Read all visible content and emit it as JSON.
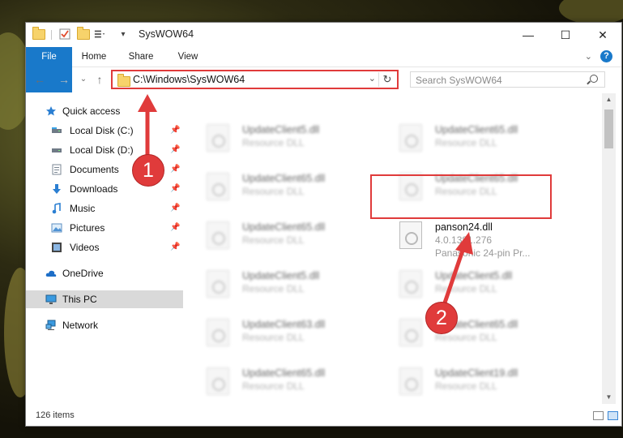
{
  "window": {
    "title": "SysWOW64",
    "minimize_glyph": "—",
    "maximize_glyph": "☐",
    "close_glyph": "✕"
  },
  "ribbon": {
    "tabs": [
      "File",
      "Home",
      "Share",
      "View"
    ],
    "expand_glyph": "⌄",
    "help_glyph": "?"
  },
  "navigation": {
    "back_glyph": "←",
    "forward_glyph": "→",
    "recent_glyph": "⌄",
    "up_glyph": "↑"
  },
  "address": {
    "path": "C:\\Windows\\SysWOW64",
    "dropdown_glyph": "⌄",
    "refresh_glyph": "↻"
  },
  "search": {
    "placeholder": "Search SysWOW64"
  },
  "sidebar": {
    "items": [
      {
        "label": "Quick access",
        "icon": "star-icon"
      },
      {
        "label": "Local Disk (C:)",
        "icon": "drive-icon",
        "pinned": true
      },
      {
        "label": "Local Disk (D:)",
        "icon": "drive-icon",
        "pinned": true
      },
      {
        "label": "Documents",
        "icon": "documents-icon",
        "pinned": true
      },
      {
        "label": "Downloads",
        "icon": "downloads-icon",
        "pinned": true
      },
      {
        "label": "Music",
        "icon": "music-icon",
        "pinned": true
      },
      {
        "label": "Pictures",
        "icon": "pictures-icon",
        "pinned": true
      },
      {
        "label": "Videos",
        "icon": "videos-icon",
        "pinned": true
      },
      {
        "label": "OneDrive",
        "icon": "cloud-icon"
      },
      {
        "label": "This PC",
        "icon": "computer-icon",
        "selected": true
      },
      {
        "label": "Network",
        "icon": "network-icon"
      }
    ],
    "pin_glyph": "📌"
  },
  "files": {
    "left_column": [
      {
        "name": "UpdateClient5.dll",
        "type": "Resource DLL"
      },
      {
        "name": "UpdateClient65.dll",
        "type": "Resource DLL"
      },
      {
        "name": "UpdateClient65.dll",
        "type": "Resource DLL"
      },
      {
        "name": "UpdateClient5.dll",
        "type": "Resource DLL"
      },
      {
        "name": "UpdateClient63.dll",
        "type": "Resource DLL"
      },
      {
        "name": "UpdateClient65.dll",
        "type": "Resource DLL"
      }
    ],
    "right_column": [
      {
        "name": "UpdateClient65.dll",
        "type": "Resource DLL"
      },
      {
        "name": "UpdateClient65.dll",
        "type": "Resource DLL"
      },
      {
        "name": "panson24.dll",
        "version": "4.0.1381.276",
        "description": "Panasonic 24-pin Pr...",
        "highlighted": true
      },
      {
        "name": "UpdateClient5.dll",
        "type": "Resource DLL"
      },
      {
        "name": "UpdateClient65.dll",
        "type": "Resource DLL"
      },
      {
        "name": "UpdateClient19.dll",
        "type": "Resource DLL"
      }
    ]
  },
  "status": {
    "item_count": "126 items"
  },
  "annotations": {
    "step1": "1",
    "step2": "2",
    "color": "#e03b3b"
  },
  "colors": {
    "accent": "#1979ca",
    "highlight": "#e03b3b",
    "selected_nav": "#d9d9d9"
  }
}
